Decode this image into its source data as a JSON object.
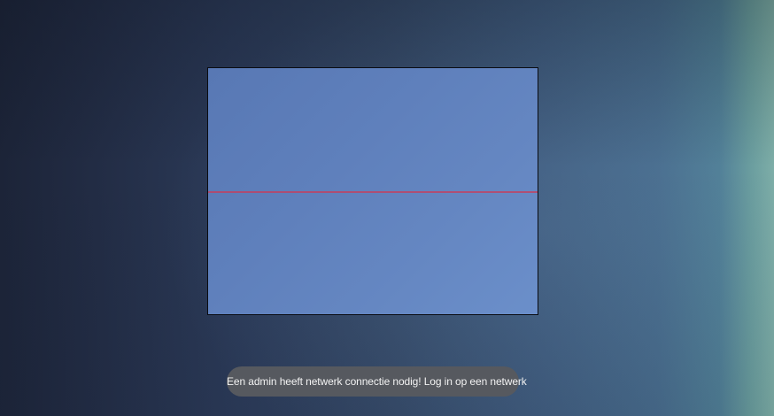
{
  "scanner": {
    "frame_color": "#0a0c12",
    "scan_line_color": "#c83c5a"
  },
  "toast": {
    "message": "Een admin heeft netwerk connectie nodig! Log in op een netwerk"
  }
}
